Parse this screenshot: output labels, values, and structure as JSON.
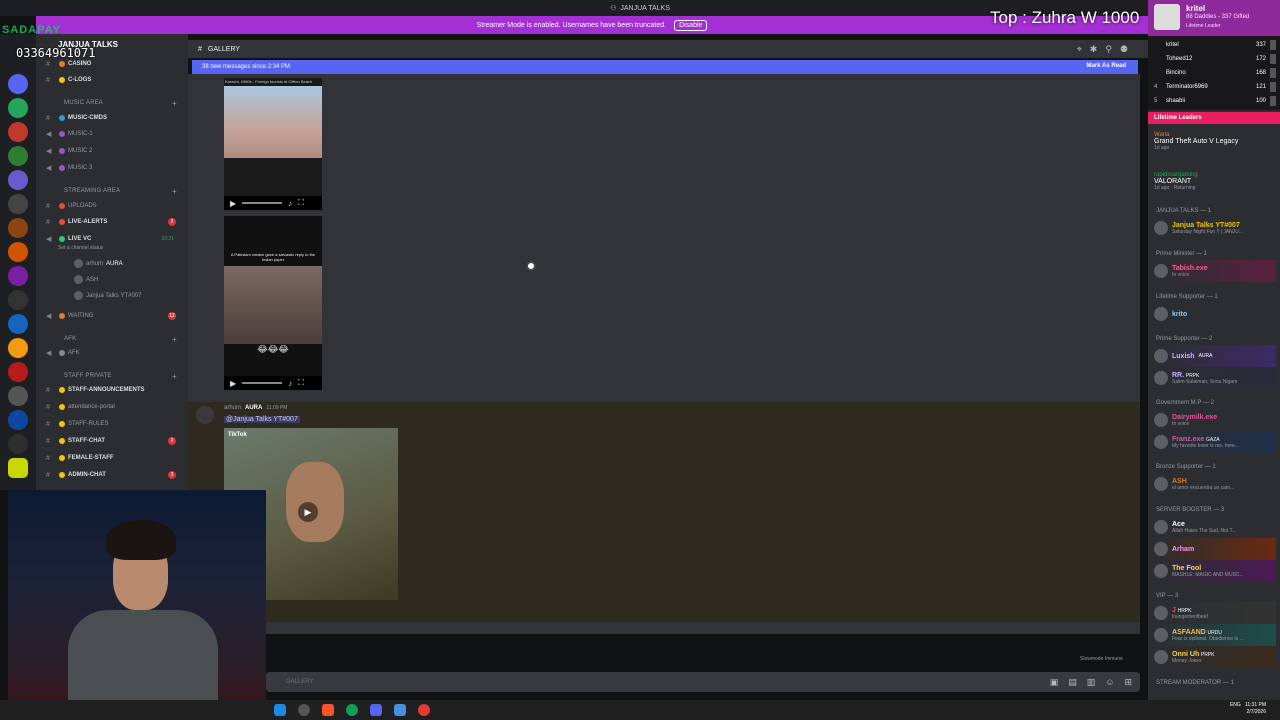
{
  "window": {
    "title": "JANJUA TALKS"
  },
  "banner": {
    "text": "Streamer Mode is enabled. Usernames have been truncated.",
    "button": "Disable"
  },
  "overlay": {
    "brand": "SADAPAY",
    "phone": "03364961071",
    "top_text": "Top : Zuhra W 1000"
  },
  "server": {
    "name": "JANJUA TALKS"
  },
  "channels": {
    "casino": "CASINO",
    "clogs": "C-LOGS",
    "music_area": "MUSIC AREA",
    "music_cmds": "MUSIC-CMDS",
    "music1": "MUSIC-1",
    "music2": "MUSIC 2",
    "music3": "MUSIC 3",
    "streaming_area": "STREAMING AREA",
    "uploads": "UPLOADS",
    "live_alerts": "LIVE-ALERTS",
    "live_vc": "LIVE VC",
    "live_vc_time": "32:21",
    "vc_status": "Set a channel status",
    "vc_user1": "arhum",
    "vc_user1_tag": "AURA",
    "vc_user2": "ASH",
    "vc_user3": "Janjua Talks YT#007",
    "waiting": "WAITING",
    "waiting_badge": "12",
    "afk_cat": "AFK",
    "afk": "AFK",
    "staff_private": "STAFF PRIVATE",
    "staff_ann": "STAFF-ANNOUNCEMENTS",
    "attendance": "attendance-portal",
    "staff_rules": "STAFF-RULES",
    "staff_chat": "STAFF-CHAT",
    "staff_chat_badge": "2",
    "female_staff": "FEMALE-STAFF",
    "admin_chat": "ADMIN-CHAT",
    "admin_chat_badge": "3",
    "live_alerts_badge": "2"
  },
  "header": {
    "channel": "GALLERY"
  },
  "new_messages": {
    "text": "38 new messages since 2:34 PM",
    "mark_read": "Mark As Read"
  },
  "messages": {
    "author": "arhum",
    "author_tag": "AURA",
    "time": "11:09 PM",
    "mention": "@Janjua Talks YT#007",
    "tiktok_label": "TikTok",
    "video1_caption": "Karachi, 1960s - Foreign tourists at Clifton Beach",
    "video2_caption": "A Pakistani creator gave a sarcastic reply to the Indian paper",
    "emoji": "😂😂😂"
  },
  "input": {
    "placeholder": "GALLERY",
    "slowmode": "Slowmode Immune"
  },
  "leaderboard": {
    "user": "kritel",
    "sub": "88 Daddies - 337 Gifted",
    "sub2": "Lifetime Leader",
    "rows": [
      {
        "rank": "",
        "name": "kritel",
        "score": "337"
      },
      {
        "rank": "",
        "name": "Toheed12",
        "score": "172"
      },
      {
        "rank": "",
        "name": "Bincino",
        "score": "168"
      },
      {
        "rank": "4",
        "name": "Terminator6969",
        "score": "121"
      },
      {
        "rank": "5",
        "name": "shaabii",
        "score": "100"
      }
    ],
    "lifetime_header": "Lifetime Leaders"
  },
  "activity": [
    {
      "name": "Warla",
      "game": "Grand Theft Auto V Legacy",
      "time": "1d ago"
    },
    {
      "name": "rapidroargaming",
      "game": "VALORANT",
      "time": "1d ago · Returning"
    }
  ],
  "members": {
    "janjua_group": "JANJUA TALKS — 1",
    "janjua": "Janjua Talks YT#007",
    "janjua_status": "Saturday Night Fun !! | JANJU...",
    "pm_group": "Prime Minister — 1",
    "pm": "Tabish.exe",
    "pm_status": "In voice",
    "ls_group": "Lifetime Supporter — 1",
    "ls": "krito",
    "ps_group": "Prime Supporter — 2",
    "ps1": "Luxish",
    "ps1_tag": "AURA",
    "ps2": "RR.",
    "ps2_tag": "PRPK",
    "ps2_status": "Salim-Sulaiman, Sonu Nigam",
    "gov_group": "Government M.P — 2",
    "gov1": "Dairymilk.exe",
    "gov1_status": "In voice",
    "gov2": "Franz.exe",
    "gov2_tag": "GAZA",
    "gov2_status": "My favorite lover is me, here...",
    "bronze_group": "Bronze Supporter — 1",
    "bronze": "ASH",
    "bronze_status": "el amor encuentra un cam...",
    "booster_group": "SERVER BOOSTER — 3",
    "b1": "Ace",
    "b1_status": "Allah Hates The Sad, Not T...",
    "b2": "Arham",
    "b3": "The Fool",
    "b3_status": "MASHLE: MAGIC AND MUSC...",
    "vip_group": "VIP — 3",
    "v1": "J",
    "v1_tag": "HRPK",
    "v1_status": "loungemeofbeef",
    "v2": "ASFAAND",
    "v2_tag": "URDU",
    "v2_status": "Fear is optional. Obedience is ...",
    "v3": "Onni Uh",
    "v3_tag": "PRPK",
    "v3_status": "Money Jokes",
    "mod_group": "STREAM MODERATOR — 1"
  },
  "taskbar": {
    "lang": "ENG",
    "time": "11:31 PM",
    "date": "2/7/2026"
  }
}
